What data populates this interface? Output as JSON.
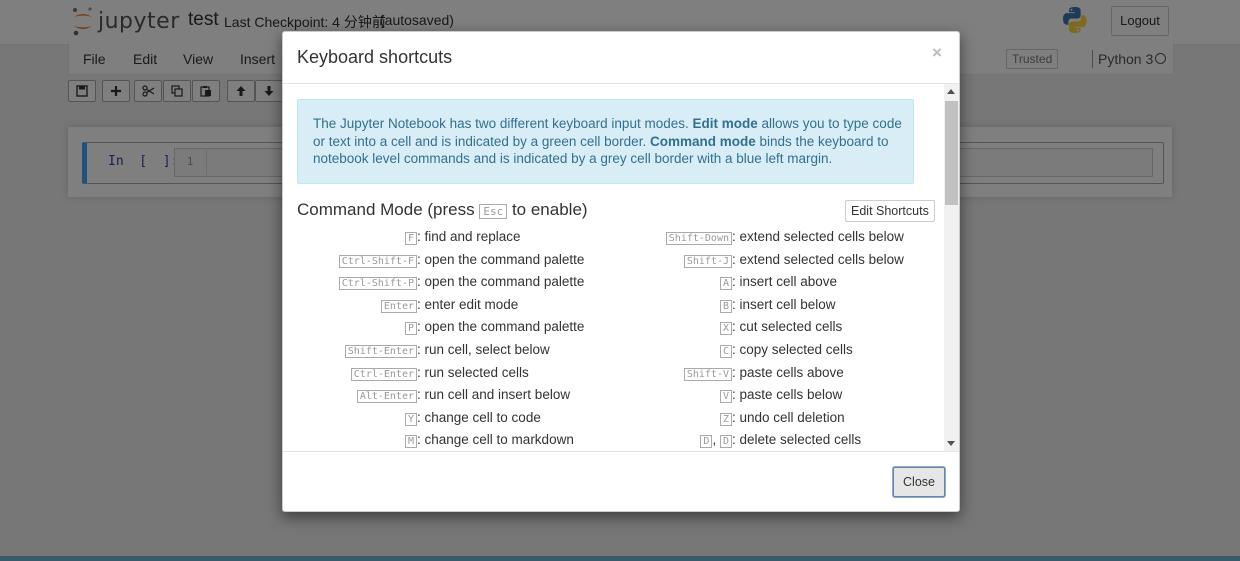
{
  "header": {
    "logo_text": "jupyter",
    "notebook_name": "test",
    "checkpoint": "Last Checkpoint: 4 分钟前",
    "autosave": "(autosaved)",
    "logout_label": "Logout"
  },
  "menubar": {
    "items": [
      "File",
      "Edit",
      "View",
      "Insert"
    ],
    "trusted": "Trusted",
    "kernel": "Python 3"
  },
  "cell": {
    "prompt": "In  [  ]:",
    "line_number": "1"
  },
  "modal": {
    "title": "Keyboard shortcuts",
    "close_x": "×",
    "info": {
      "t1": "The Jupyter Notebook has two different keyboard input modes. ",
      "b1": "Edit mode",
      "t2": " allows you to type code or text into a cell and is indicated by a green cell border. ",
      "b2": "Command mode",
      "t3": " binds the keyboard to notebook level commands and is indicated by a grey cell border with a blue left margin."
    },
    "command_mode": {
      "prefix": "Command Mode (press ",
      "key": "Esc",
      "suffix": " to enable)"
    },
    "edit_shortcuts_label": "Edit Shortcuts",
    "left_shortcuts": [
      {
        "keys": [
          "F"
        ],
        "desc": ": find and replace"
      },
      {
        "keys": [
          "Ctrl-Shift-F"
        ],
        "desc": ": open the command palette"
      },
      {
        "keys": [
          "Ctrl-Shift-P"
        ],
        "desc": ": open the command palette"
      },
      {
        "keys": [
          "Enter"
        ],
        "desc": ": enter edit mode"
      },
      {
        "keys": [
          "P"
        ],
        "desc": ": open the command palette"
      },
      {
        "keys": [
          "Shift-Enter"
        ],
        "desc": ": run cell, select below"
      },
      {
        "keys": [
          "Ctrl-Enter"
        ],
        "desc": ": run selected cells"
      },
      {
        "keys": [
          "Alt-Enter"
        ],
        "desc": ": run cell and insert below"
      },
      {
        "keys": [
          "Y"
        ],
        "desc": ": change cell to code"
      },
      {
        "keys": [
          "M"
        ],
        "desc": ": change cell to markdown"
      }
    ],
    "right_shortcuts": [
      {
        "keys": [
          "Shift-Down"
        ],
        "desc": ": extend selected cells below"
      },
      {
        "keys": [
          "Shift-J"
        ],
        "desc": ": extend selected cells below"
      },
      {
        "keys": [
          "A"
        ],
        "desc": ": insert cell above"
      },
      {
        "keys": [
          "B"
        ],
        "desc": ": insert cell below"
      },
      {
        "keys": [
          "X"
        ],
        "desc": ": cut selected cells"
      },
      {
        "keys": [
          "C"
        ],
        "desc": ": copy selected cells"
      },
      {
        "keys": [
          "Shift-V"
        ],
        "desc": ": paste cells above"
      },
      {
        "keys": [
          "V"
        ],
        "desc": ": paste cells below"
      },
      {
        "keys": [
          "Z"
        ],
        "desc": ": undo cell deletion"
      },
      {
        "keys": [
          "D",
          "D"
        ],
        "desc": ": delete selected cells"
      }
    ],
    "close_label": "Close"
  },
  "toolbar_icons": [
    "save-icon",
    "plus-icon",
    "cut-icon",
    "copy-icon",
    "paste-icon",
    "arrow-up-icon",
    "arrow-down-icon"
  ]
}
